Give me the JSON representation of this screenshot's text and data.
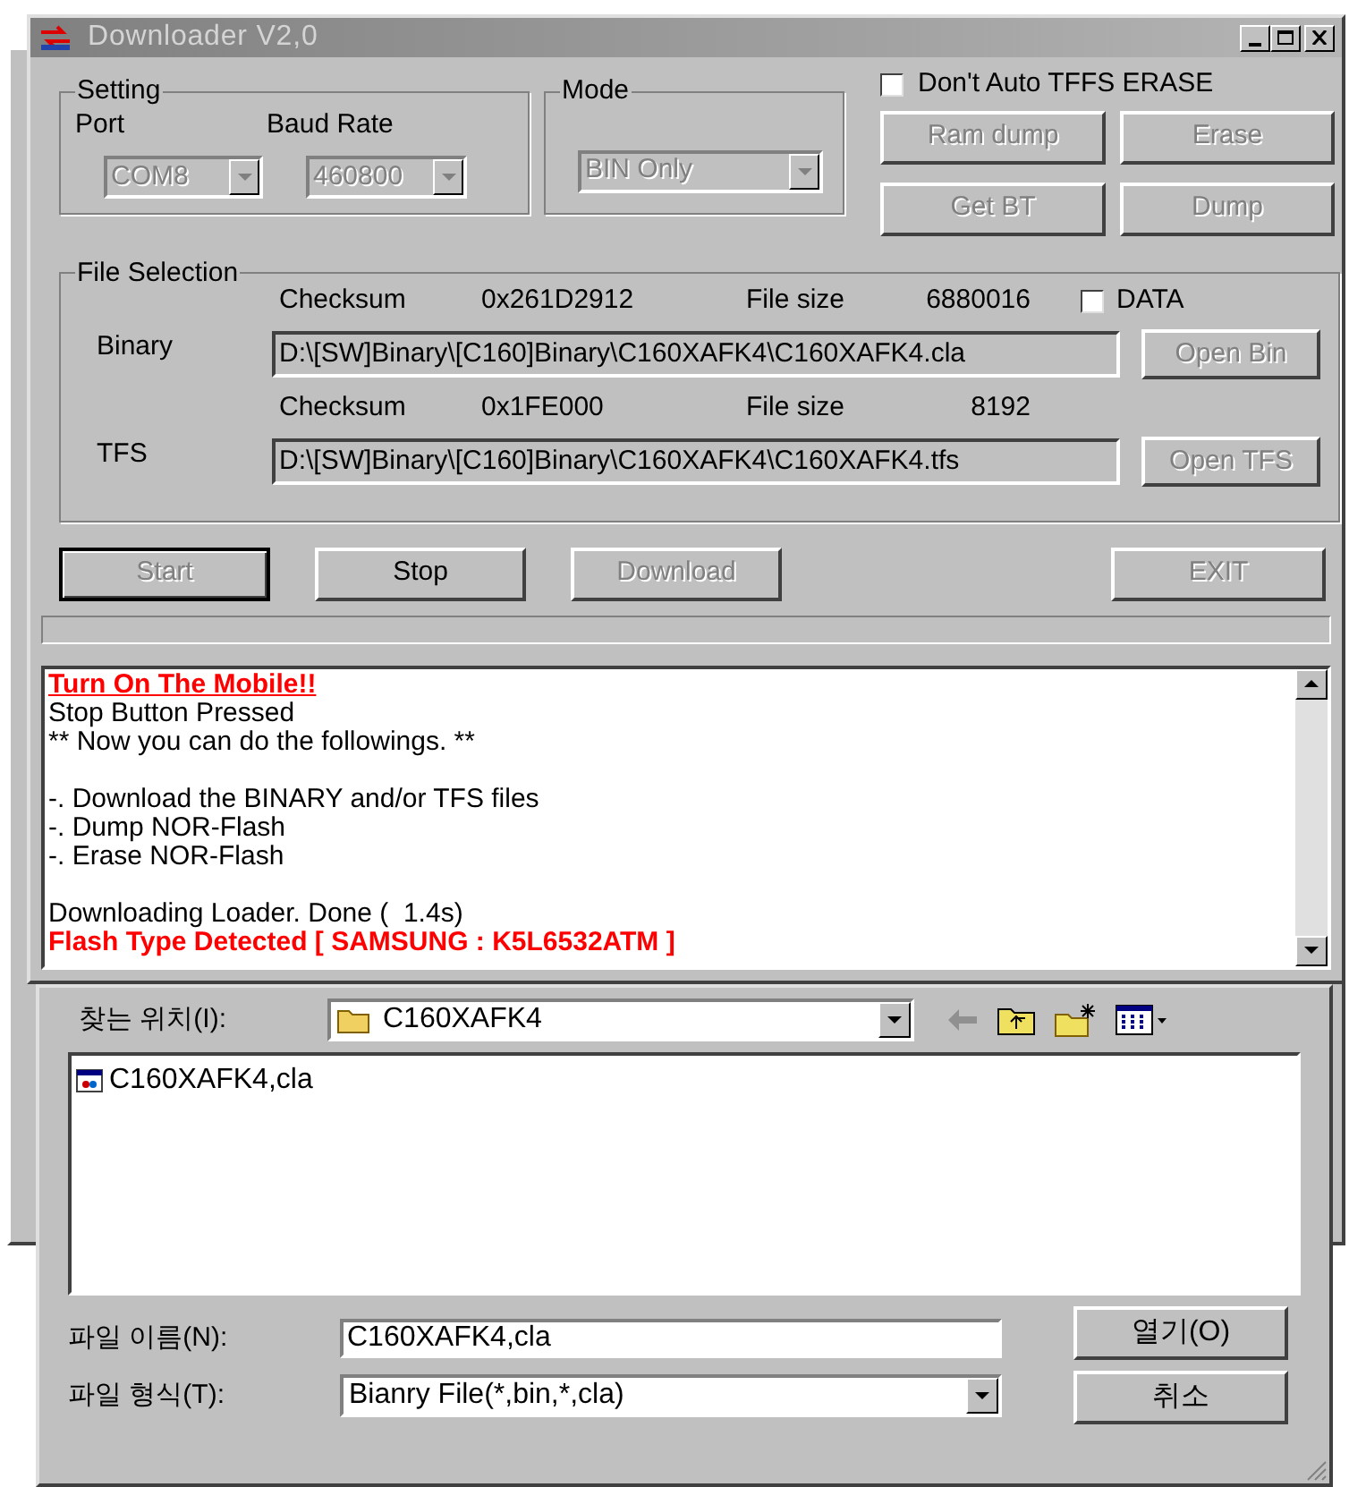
{
  "window": {
    "title": "Downloader V2,0"
  },
  "setting": {
    "legend": "Setting",
    "port_label": "Port",
    "port": {
      "value": "COM8",
      "disabled": true
    },
    "baud_label": "Baud Rate",
    "baud": {
      "value": "460800",
      "disabled": true
    }
  },
  "mode": {
    "legend": "Mode",
    "value": "BIN Only",
    "disabled": true
  },
  "tffs_checkbox": {
    "label": "Don't Auto TFFS ERASE",
    "checked": false
  },
  "tool_buttons": [
    {
      "label": "Ram dump",
      "disabled": true
    },
    {
      "label": "Erase",
      "disabled": true
    },
    {
      "label": "Get BT",
      "disabled": true
    },
    {
      "label": "Dump",
      "disabled": true
    }
  ],
  "file_selection": {
    "legend": "File Selection",
    "data_checkbox": {
      "label": "DATA",
      "checked": false
    },
    "files": [
      {
        "label": "Binary",
        "checksum_label": "Checksum",
        "checksum": "0x261D2912",
        "size_label": "File size",
        "size": "6880016",
        "path": "D:\\[SW]Binary\\[C160]Binary\\C160XAFK4\\C160XAFK4.cla",
        "button": {
          "label": "Open Bin",
          "disabled": true
        }
      },
      {
        "label": "TFS",
        "checksum_label": "Checksum",
        "checksum": "0x1FE000",
        "size_label": "File size",
        "size": "8192",
        "path": "D:\\[SW]Binary\\[C160]Binary\\C160XAFK4\\C160XAFK4.tfs",
        "button": {
          "label": "Open TFS",
          "disabled": true
        }
      }
    ]
  },
  "action_buttons": [
    {
      "label": "Start",
      "disabled": true,
      "default": true
    },
    {
      "label": "Stop",
      "disabled": false,
      "default": false
    },
    {
      "label": "Download",
      "disabled": true,
      "default": false
    },
    {
      "label": "EXIT",
      "disabled": true,
      "default": false
    }
  ],
  "progress": {
    "level": 0
  },
  "log": [
    {
      "kind": "alert",
      "text": "Turn On The Mobile!!"
    },
    {
      "kind": "normal",
      "text": "Stop Button Pressed"
    },
    {
      "kind": "normal",
      "text": "** Now you can do the followings. **"
    },
    {
      "kind": "blank"
    },
    {
      "kind": "normal",
      "text": "-. Download the BINARY and/or TFS files"
    },
    {
      "kind": "normal",
      "text": "-. Dump NOR-Flash"
    },
    {
      "kind": "normal",
      "text": "-. Erase NOR-Flash"
    },
    {
      "kind": "blank"
    },
    {
      "kind": "normal",
      "text": "Downloading Loader. Done (  1.4s)"
    },
    {
      "kind": "error",
      "text": "Flash Type Detected [ SAMSUNG : K5L6532ATM ]"
    }
  ],
  "open_dialog": {
    "look_in_label": "찾는 위치(I):",
    "look_in": "C160XAFK4",
    "files": [
      {
        "name": "C160XAFK4,cla",
        "selected": false
      }
    ],
    "file_name_label": "파일 이름(N):",
    "file_name": "C160XAFK4,cla",
    "file_type_label": "파일 형식(T):",
    "file_type": "Bianry File(*,bin,*,cla)",
    "open_button": "열기(O)",
    "cancel_button": "취소"
  }
}
